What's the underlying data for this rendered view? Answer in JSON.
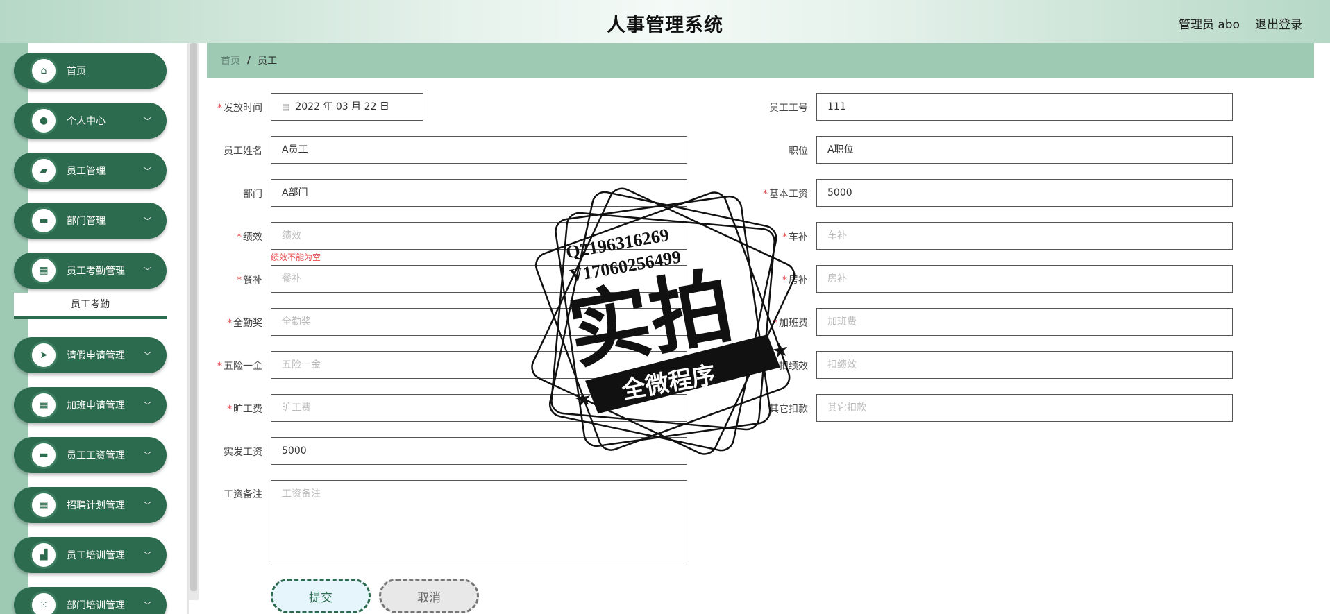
{
  "header": {
    "title": "人事管理系统",
    "user": "管理员 abo",
    "logout": "退出登录"
  },
  "sidebar": {
    "items": [
      {
        "label": "首页",
        "icon": "home-icon",
        "glyph": "⌂"
      },
      {
        "label": "个人中心",
        "icon": "user-icon",
        "glyph": "●"
      },
      {
        "label": "员工管理",
        "icon": "wallet-icon",
        "glyph": "▰"
      },
      {
        "label": "部门管理",
        "icon": "chat-icon",
        "glyph": "▬"
      },
      {
        "label": "员工考勤管理",
        "icon": "grid-icon",
        "glyph": "▦"
      },
      {
        "label": "请假申请管理",
        "icon": "send-icon",
        "glyph": "➤"
      },
      {
        "label": "加班申请管理",
        "icon": "grid-icon",
        "glyph": "▦"
      },
      {
        "label": "员工工资管理",
        "icon": "briefcase-icon",
        "glyph": "▬"
      },
      {
        "label": "招聘计划管理",
        "icon": "grid-icon",
        "glyph": "▦"
      },
      {
        "label": "员工培训管理",
        "icon": "chair-icon",
        "glyph": "▟"
      },
      {
        "label": "部门培训管理",
        "icon": "apps-icon",
        "glyph": "⁙"
      }
    ],
    "submenu": "员工考勤"
  },
  "breadcrumb": {
    "home": "首页",
    "separator": "/",
    "current": "员工"
  },
  "form": {
    "release_time": {
      "label": "发放时间",
      "value": "2022 年 03 月 22 日"
    },
    "employee_no": {
      "label": "员工工号",
      "value": "111"
    },
    "employee_name": {
      "label": "员工姓名",
      "value": "A员工"
    },
    "position": {
      "label": "职位",
      "value": "A职位"
    },
    "department": {
      "label": "部门",
      "value": "A部门"
    },
    "base_salary": {
      "label": "基本工资",
      "value": "5000"
    },
    "performance": {
      "label": "绩效",
      "placeholder": "绩效",
      "error": "绩效不能为空"
    },
    "car_allowance": {
      "label": "车补",
      "placeholder": "车补"
    },
    "meal_allowance": {
      "label": "餐补",
      "placeholder": "餐补"
    },
    "housing_allowance": {
      "label": "房补",
      "placeholder": "房补"
    },
    "attendance_bonus": {
      "label": "全勤奖",
      "placeholder": "全勤奖"
    },
    "overtime_pay": {
      "label": "加班费",
      "placeholder": "加班费"
    },
    "insurance": {
      "label": "五险一金",
      "placeholder": "五险一金"
    },
    "deduct_performance": {
      "label": "扣绩效",
      "placeholder": "扣绩效"
    },
    "absence_fee": {
      "label": "旷工费",
      "placeholder": "旷工费"
    },
    "other_deductions": {
      "label": "其它扣款",
      "placeholder": "其它扣款"
    },
    "actual_salary": {
      "label": "实发工资",
      "value": "5000"
    },
    "salary_note": {
      "label": "工资备注",
      "placeholder": "工资备注"
    },
    "submit": "提交",
    "cancel": "取消"
  },
  "watermark": {
    "line1": "Q2196316269",
    "line2": "V17060256499",
    "main": "实拍",
    "banner": "全微程序"
  },
  "colors": {
    "primary": "#2d6b4e",
    "accent_light": "#9ec9b3",
    "error": "#e84a4a"
  }
}
